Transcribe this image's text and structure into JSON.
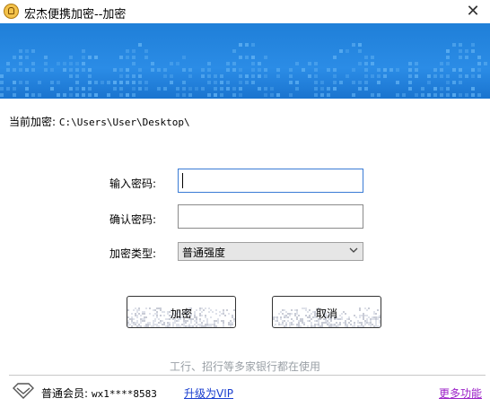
{
  "window": {
    "title": "宏杰便携加密--加密",
    "close_glyph": "✕"
  },
  "banner": {
    "colors": {
      "primary": "#2b8ce6",
      "dots": "#5fb0f2"
    }
  },
  "current": {
    "label": "当前加密:",
    "path": "C:\\Users\\User\\Desktop\\"
  },
  "form": {
    "password_label": "输入密码:",
    "password_value": "",
    "confirm_label": "确认密码:",
    "confirm_value": "",
    "type_label": "加密类型:",
    "type_selected": "普通强度"
  },
  "buttons": {
    "encrypt": "加密",
    "cancel": "取消"
  },
  "slogan": "工行、招行等多家银行都在使用",
  "footer": {
    "member_label": "普通会员:",
    "user_id": "wx1****8583",
    "upgrade": "升级为VIP",
    "more": "更多功能",
    "colors": {
      "upgrade": "#1a3ecf",
      "more": "#9b1fc7"
    }
  }
}
